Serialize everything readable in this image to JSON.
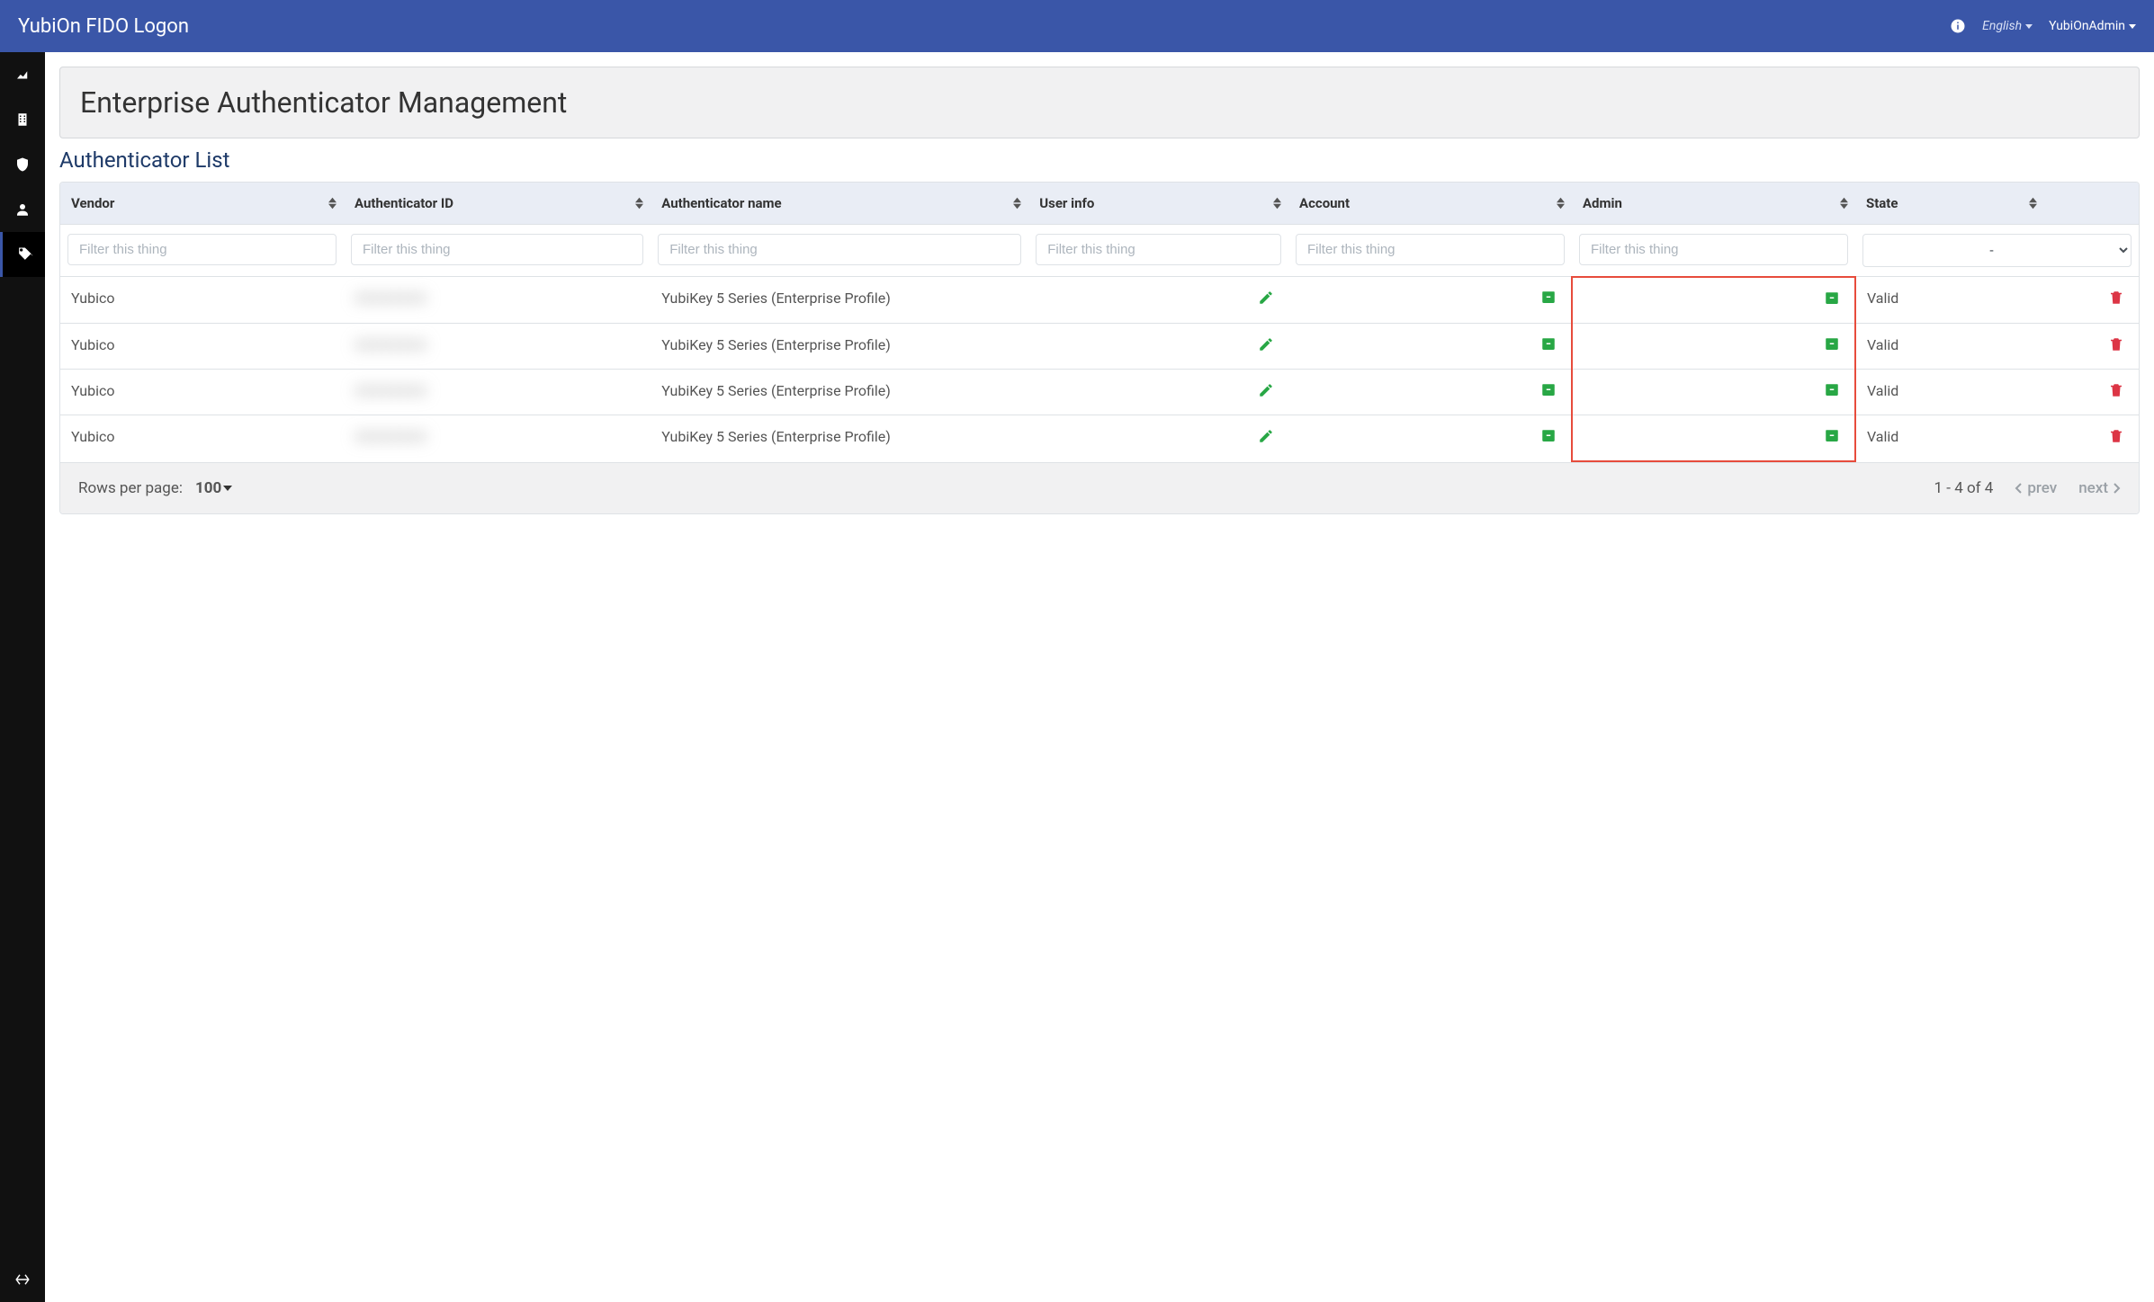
{
  "brand": "YubiOn FIDO Logon",
  "top": {
    "language": "English",
    "user": "YubiOnAdmin"
  },
  "page": {
    "title": "Enterprise Authenticator Management",
    "subtitle": "Authenticator List"
  },
  "table": {
    "columns": {
      "vendor": "Vendor",
      "authid": "Authenticator ID",
      "name": "Authenticator name",
      "user": "User info",
      "account": "Account",
      "admin": "Admin",
      "state": "State"
    },
    "filter_placeholder": "Filter this thing",
    "state_filter_selected": "-",
    "rows": [
      {
        "vendor": "Yubico",
        "authid": "XXXXXXXX",
        "name": "YubiKey 5 Series (Enterprise Profile)",
        "state": "Valid"
      },
      {
        "vendor": "Yubico",
        "authid": "XXXXXXXX",
        "name": "YubiKey 5 Series (Enterprise Profile)",
        "state": "Valid"
      },
      {
        "vendor": "Yubico",
        "authid": "XXXXXXXX",
        "name": "YubiKey 5 Series (Enterprise Profile)",
        "state": "Valid"
      },
      {
        "vendor": "Yubico",
        "authid": "XXXXXXXX",
        "name": "YubiKey 5 Series (Enterprise Profile)",
        "state": "Valid"
      }
    ]
  },
  "footer": {
    "rows_label": "Rows per page:",
    "rows_value": "100",
    "range": "1 - 4 of 4",
    "prev": "prev",
    "next": "next"
  }
}
